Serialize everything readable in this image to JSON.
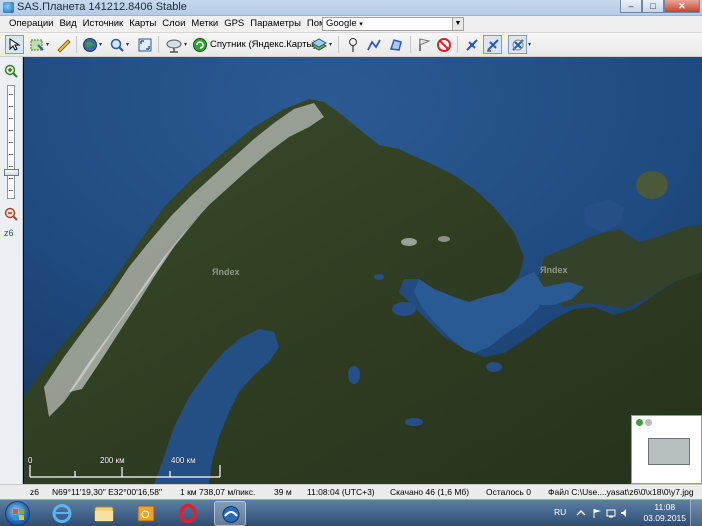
{
  "window": {
    "title": "SAS.Планета 141212.8406 Stable",
    "controls": {
      "minimize": "–",
      "maximize": "□",
      "close": "✕"
    }
  },
  "menu": {
    "items": [
      "Операции",
      "Вид",
      "Источник",
      "Карты",
      "Слои",
      "Метки",
      "GPS",
      "Параметры",
      "Помощь"
    ],
    "search_combo": "Google",
    "search_combo_arrow": "▾",
    "combo_button_arrow": "▼"
  },
  "toolbar": {
    "map_source_label": "Спутник (Яндекс.Карты)",
    "dropdown_glyph": "▾"
  },
  "left_panel": {
    "zoom_level": "z6"
  },
  "map": {
    "watermark": "Яndex",
    "scale_labels": [
      "0",
      "200 км",
      "400 км"
    ]
  },
  "status": {
    "zoom": "z6",
    "coordinates": "N69°11'19,30\" E32°00'16,58\"",
    "scale": "1 км 738,07 м/пикс.",
    "altitude": "39 м",
    "time": "11:08:04 (UTC+3)",
    "downloaded": "Скачано 46 (1,6 Мб)",
    "remaining": "Осталось 0",
    "file": "Файл C:\\Use....yasat\\z6\\0\\x18\\0\\y7.jpg"
  },
  "taskbar": {
    "language": "RU",
    "clock_time": "11:08",
    "clock_date": "03.09.2015"
  }
}
